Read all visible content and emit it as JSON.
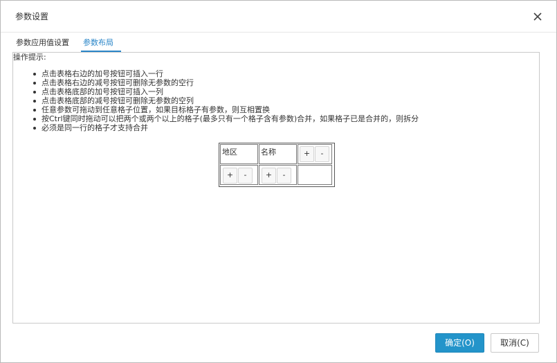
{
  "dialog": {
    "title": "参数设置",
    "close_icon": "close-icon"
  },
  "tabs": [
    {
      "label": "参数应用值设置",
      "active": false
    },
    {
      "label": "参数布局",
      "active": true
    }
  ],
  "colors": {
    "accent": "#2a86c8",
    "primary_button": "#2394ca"
  },
  "hints": {
    "title": "操作提示:",
    "items": [
      "点击表格右边的加号按钮可插入一行",
      "点击表格右边的减号按钮可删除无参数的空行",
      "点击表格底部的加号按钮可插入一列",
      "点击表格底部的减号按钮可删除无参数的空列",
      "任意参数可拖动到任意格子位置，如果目标格子有参数，则互相置换",
      "按Ctrl键同时拖动可以把两个或两个以上的格子(最多只有一个格子含有参数)合并，如果格子已是合并的，则拆分",
      "必须是同一行的格子才支持合并"
    ]
  },
  "layout_grid": {
    "cells": [
      "地区",
      "名称"
    ],
    "add_label": "+",
    "remove_label": "-"
  },
  "footer": {
    "ok_label": "确定(O)",
    "cancel_label": "取消(C)"
  }
}
